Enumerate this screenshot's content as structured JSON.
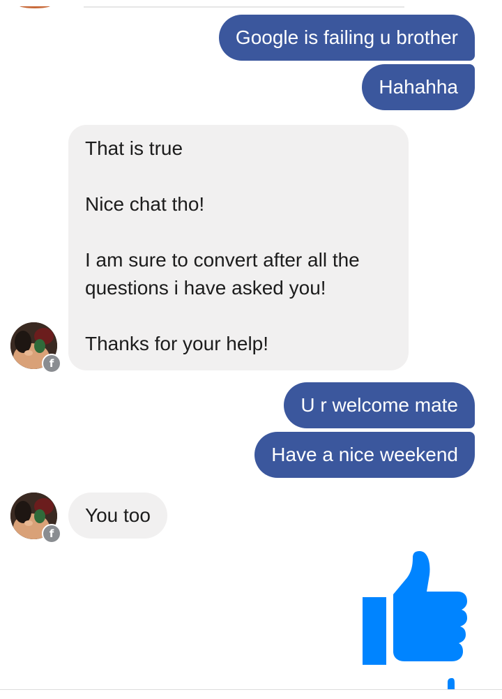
{
  "messages": {
    "m1": "Google is failing u brother",
    "m2": "Hahahha",
    "m3": {
      "p1": "That is true",
      "p2": "Nice chat tho!",
      "p3": "I am sure to convert after all the questions i have asked you!",
      "p4": "Thanks for your help!"
    },
    "m4": "U r welcome mate",
    "m5": "Have a nice weekend",
    "m6": "You too"
  },
  "badge": {
    "glyph": "f"
  },
  "icons": {
    "like": "thumbs-up-icon",
    "avatar_badge": "facebook-badge-icon"
  },
  "colors": {
    "outgoing_bubble": "#3b579d",
    "incoming_bubble": "#f1f0f0",
    "like_blue": "#0084ff"
  }
}
